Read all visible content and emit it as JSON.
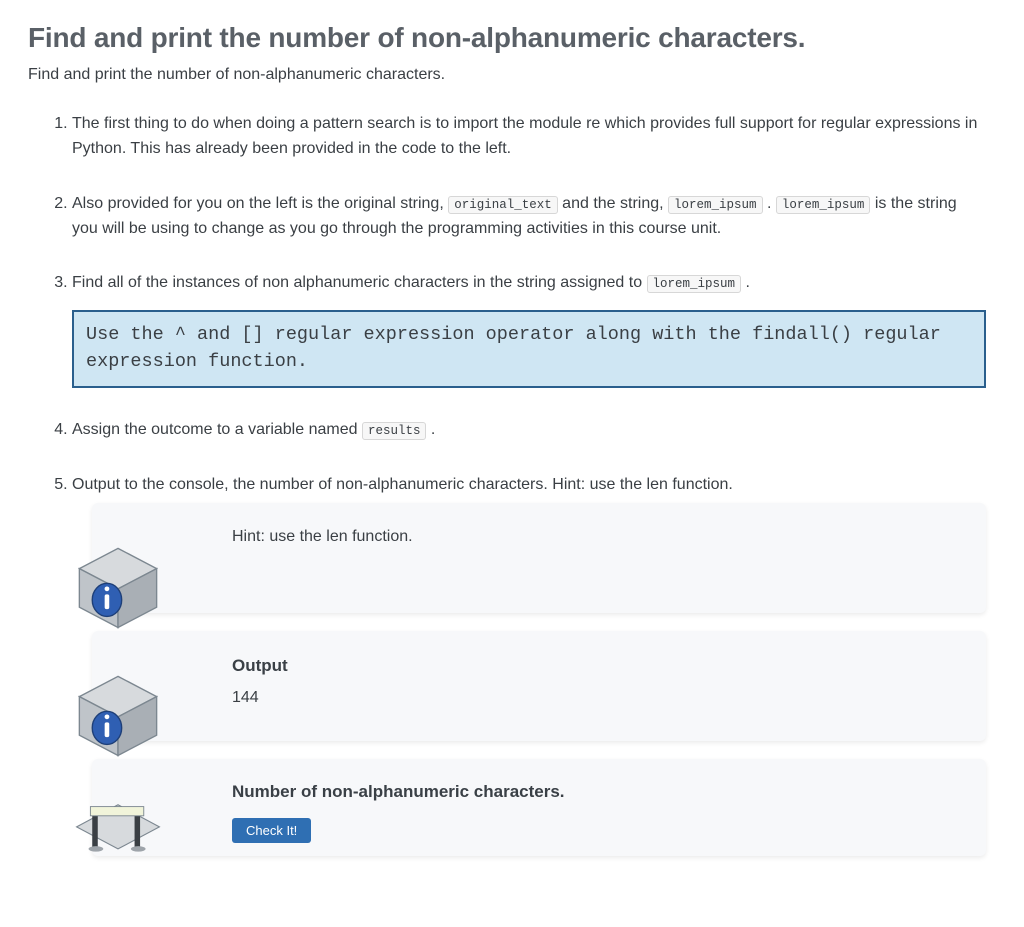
{
  "header": {
    "title": "Find and print the number of non-alphanumeric characters.",
    "subtitle": "Find and print the number of non-alphanumeric characters."
  },
  "steps": {
    "s1": "The first thing to do when doing a pattern search is to import the module re which provides full support for regular expressions in Python. This has already been provided in the code to the left.",
    "s2_a": "Also provided for you on the left is the original string, ",
    "s2_code1": "original_text",
    "s2_b": " and the string, ",
    "s2_code2": "lorem_ipsum",
    "s2_c": " . ",
    "s2_code3": "lorem_ipsum",
    "s2_d": " is the string you will be using to change as you go through the programming activities in this course unit.",
    "s3_a": "Find all of the instances of non alphanumeric characters in the string assigned to ",
    "s3_code": "lorem_ipsum",
    "s3_b": " .",
    "callout": "Use the ^ and [] regular expression operator along with the findall() regular expression function.",
    "s4_a": "Assign the outcome to a variable named ",
    "s4_code": "results",
    "s4_b": " .",
    "s5": "Output to the console, the number of non-alphanumeric characters. Hint: use the len function."
  },
  "cards": {
    "hint": {
      "text": "Hint: use the len function."
    },
    "output": {
      "title": "Output",
      "value": "144"
    },
    "check": {
      "title": "Number of non-alphanumeric characters.",
      "button": "Check It!"
    }
  }
}
